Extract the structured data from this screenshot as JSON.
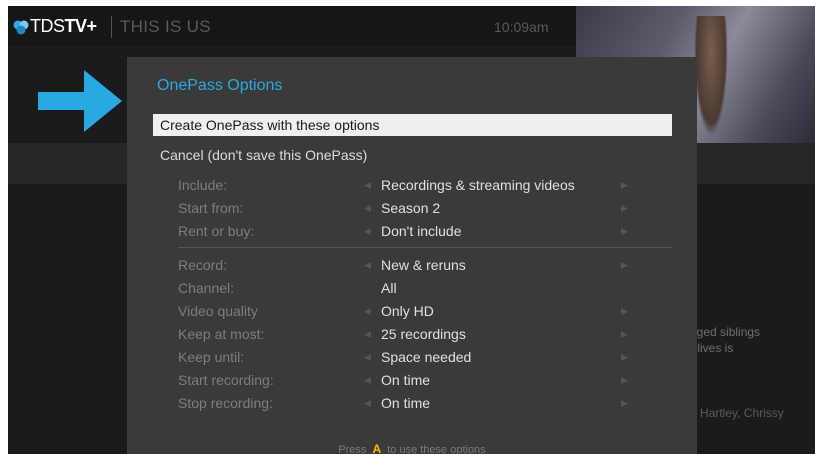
{
  "header": {
    "brand_prefix": "TDS",
    "brand_suffix": "TV+",
    "show_title": "THIS IS US",
    "clock": "10:09am"
  },
  "background": {
    "description_line1": "aged siblings",
    "description_line2": "r lives is",
    "credits_fragment": "Hartley, Chrissy"
  },
  "dialog": {
    "title": "OnePass Options",
    "selected_option": "Create OnePass with these options",
    "cancel_option": "Cancel (don't save this OnePass)",
    "settings": [
      {
        "label": "Include:",
        "value": "Recordings & streaming videos"
      },
      {
        "label": "Start from:",
        "value": "Season 2"
      },
      {
        "label": "Rent or buy:",
        "value": "Don't include"
      },
      {
        "label": "Record:",
        "value": "New & reruns"
      },
      {
        "label": "Channel:",
        "value": "All"
      },
      {
        "label": "Video quality",
        "value": "Only HD"
      },
      {
        "label": "Keep at most:",
        "value": "25 recordings"
      },
      {
        "label": "Keep until:",
        "value": "Space needed"
      },
      {
        "label": "Start recording:",
        "value": "On time"
      },
      {
        "label": "Stop recording:",
        "value": "On time"
      }
    ],
    "footer_prefix": "Press",
    "footer_key": "A",
    "footer_suffix": "to use these options"
  },
  "colors": {
    "accent": "#29a9e1",
    "key_highlight": "#f2c200",
    "dialog_bg": "#3a3a3a"
  },
  "icons": {
    "brand": "tds-logo-icon",
    "pointer": "right-arrow-icon",
    "left": "chevron-left-icon",
    "right": "chevron-right-icon"
  }
}
